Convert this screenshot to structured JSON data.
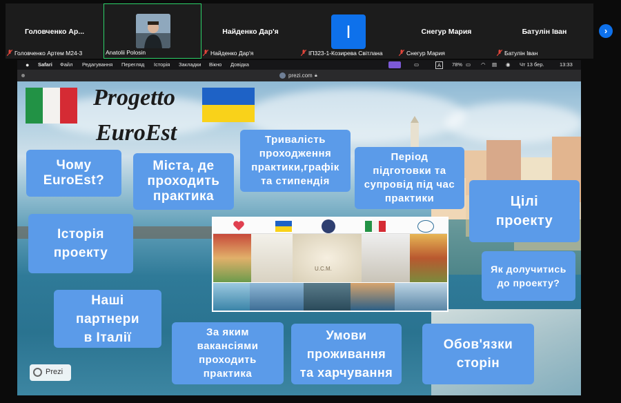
{
  "participants": [
    {
      "big_name": "Головченко  Ар...",
      "caption": "Головченко Артем М24-3",
      "muted": true
    },
    {
      "caption": "Anatolii Polosin",
      "muted": false,
      "has_video": true
    },
    {
      "big_name": "Найденко Дар'я",
      "caption": "Найденко Дар'я",
      "muted": true
    },
    {
      "initial": "I",
      "caption": "ІП323-1-Козирева Світлана",
      "muted": true
    },
    {
      "big_name": "Снегур Мария",
      "caption": "Снегур Мария",
      "muted": true
    },
    {
      "big_name": "Батулін Іван",
      "caption": "Батулін Іван",
      "muted": true
    }
  ],
  "menubar": {
    "app": "Safari",
    "items": [
      "Файл",
      "Редагування",
      "Перегляд",
      "Історія",
      "Закладки",
      "Вікно",
      "Довідка"
    ],
    "keyboard": "A",
    "battery": "78%",
    "datetime": "Чт 13 бер.",
    "time": "13:33"
  },
  "browser": {
    "url": "prezi.com"
  },
  "slide": {
    "title_line1": "Progetto",
    "title_line2": "EuroEst",
    "buttons": {
      "why": [
        "Чому",
        "EuroEst?"
      ],
      "cities": [
        "Міста, де",
        "проходить",
        "практика"
      ],
      "duration": [
        "Тривалість",
        "проходження",
        "практики,графік",
        "та стипендія"
      ],
      "preparation": [
        "Період",
        "підготовки та",
        "супровід під час",
        "практики"
      ],
      "goals": [
        "Цілі",
        "проекту"
      ],
      "history": [
        "Історія",
        "проекту"
      ],
      "join": [
        "Як долучитись",
        "до проекту?"
      ],
      "partners": [
        "Наші",
        "партнери",
        "в Італії"
      ],
      "vacancies": [
        "За яким",
        "вакансіями",
        "проходить",
        "практика"
      ],
      "living": [
        "Умови",
        "проживання",
        "та харчування"
      ],
      "duties": [
        "Обов'язки",
        "сторін"
      ]
    },
    "prezi_badge": "Prezi",
    "collage_caption": "U.C.M."
  },
  "colors": {
    "button": "#5b9be9",
    "active_border": "#2dd36a",
    "accent": "#0e71eb"
  }
}
